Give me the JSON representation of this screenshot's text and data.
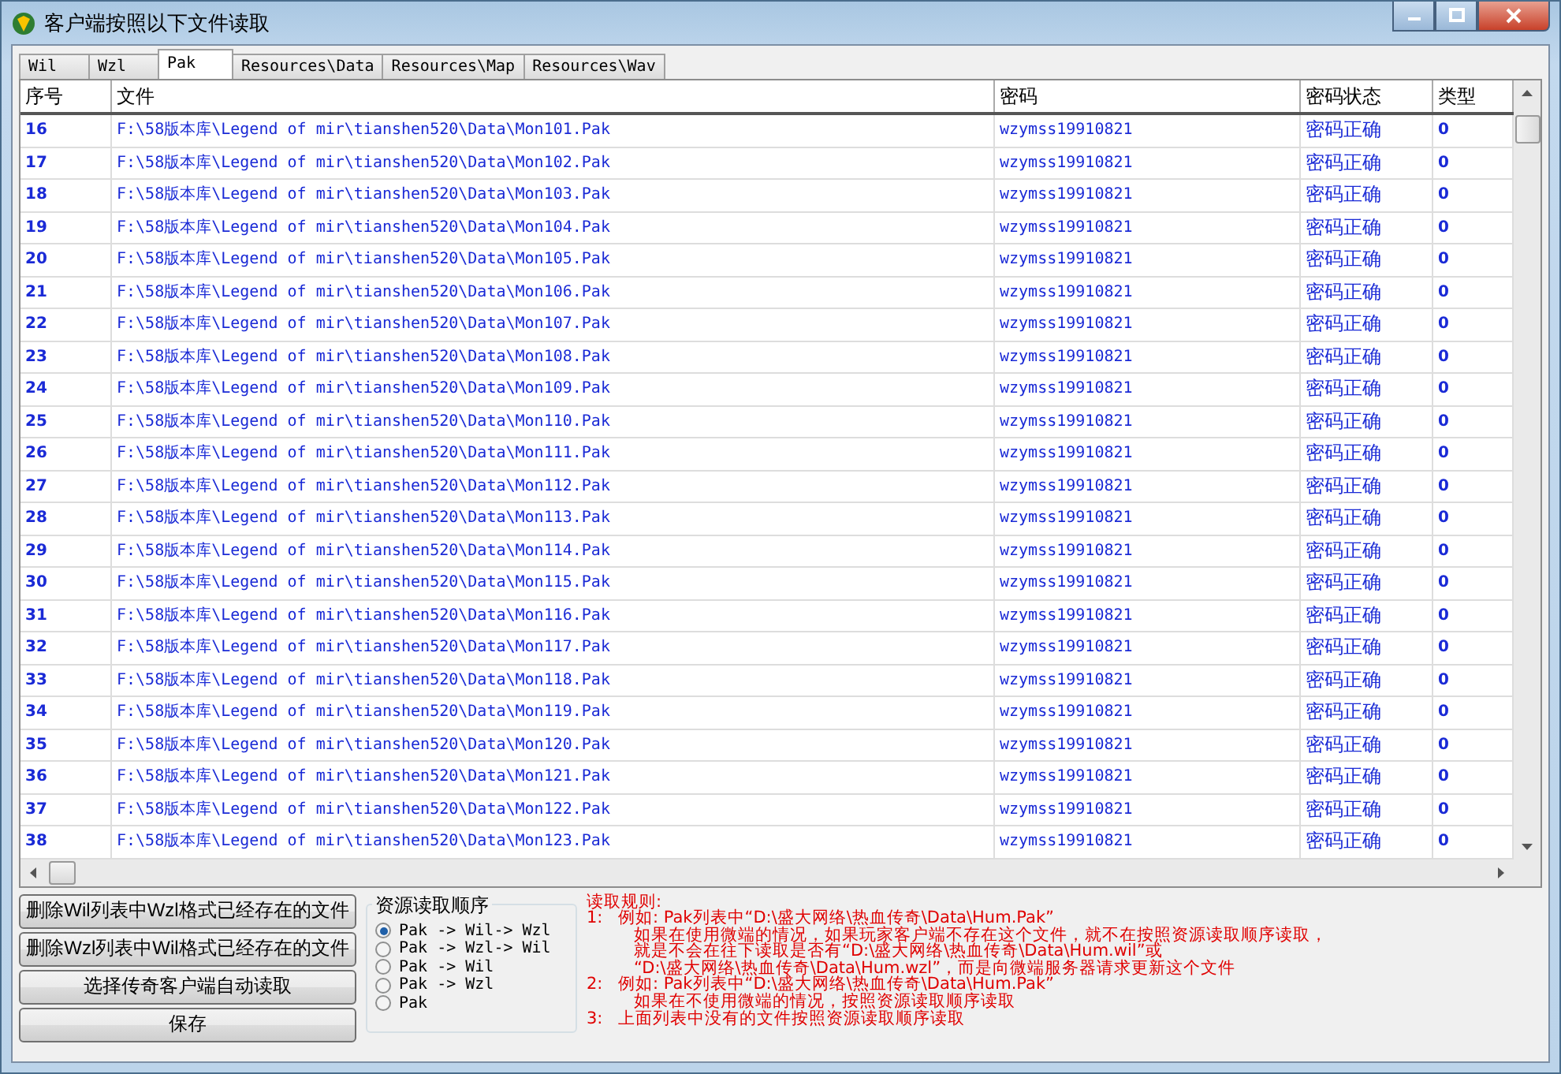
{
  "window": {
    "title": "客户端按照以下文件读取"
  },
  "tabs": [
    {
      "label": "Wil",
      "selected": false
    },
    {
      "label": "Wzl",
      "selected": false
    },
    {
      "label": "Pak",
      "selected": true
    },
    {
      "label": "Resources\\Data",
      "selected": false
    },
    {
      "label": "Resources\\Map",
      "selected": false
    },
    {
      "label": "Resources\\Wav",
      "selected": false
    }
  ],
  "table": {
    "columns": [
      "序号",
      "文件",
      "密码",
      "密码状态",
      "类型"
    ],
    "rows": [
      [
        "16",
        "F:\\58版本库\\Legend of mir\\tianshen520\\Data\\Mon101.Pak",
        "wzymss19910821",
        "密码正确",
        "0"
      ],
      [
        "17",
        "F:\\58版本库\\Legend of mir\\tianshen520\\Data\\Mon102.Pak",
        "wzymss19910821",
        "密码正确",
        "0"
      ],
      [
        "18",
        "F:\\58版本库\\Legend of mir\\tianshen520\\Data\\Mon103.Pak",
        "wzymss19910821",
        "密码正确",
        "0"
      ],
      [
        "19",
        "F:\\58版本库\\Legend of mir\\tianshen520\\Data\\Mon104.Pak",
        "wzymss19910821",
        "密码正确",
        "0"
      ],
      [
        "20",
        "F:\\58版本库\\Legend of mir\\tianshen520\\Data\\Mon105.Pak",
        "wzymss19910821",
        "密码正确",
        "0"
      ],
      [
        "21",
        "F:\\58版本库\\Legend of mir\\tianshen520\\Data\\Mon106.Pak",
        "wzymss19910821",
        "密码正确",
        "0"
      ],
      [
        "22",
        "F:\\58版本库\\Legend of mir\\tianshen520\\Data\\Mon107.Pak",
        "wzymss19910821",
        "密码正确",
        "0"
      ],
      [
        "23",
        "F:\\58版本库\\Legend of mir\\tianshen520\\Data\\Mon108.Pak",
        "wzymss19910821",
        "密码正确",
        "0"
      ],
      [
        "24",
        "F:\\58版本库\\Legend of mir\\tianshen520\\Data\\Mon109.Pak",
        "wzymss19910821",
        "密码正确",
        "0"
      ],
      [
        "25",
        "F:\\58版本库\\Legend of mir\\tianshen520\\Data\\Mon110.Pak",
        "wzymss19910821",
        "密码正确",
        "0"
      ],
      [
        "26",
        "F:\\58版本库\\Legend of mir\\tianshen520\\Data\\Mon111.Pak",
        "wzymss19910821",
        "密码正确",
        "0"
      ],
      [
        "27",
        "F:\\58版本库\\Legend of mir\\tianshen520\\Data\\Mon112.Pak",
        "wzymss19910821",
        "密码正确",
        "0"
      ],
      [
        "28",
        "F:\\58版本库\\Legend of mir\\tianshen520\\Data\\Mon113.Pak",
        "wzymss19910821",
        "密码正确",
        "0"
      ],
      [
        "29",
        "F:\\58版本库\\Legend of mir\\tianshen520\\Data\\Mon114.Pak",
        "wzymss19910821",
        "密码正确",
        "0"
      ],
      [
        "30",
        "F:\\58版本库\\Legend of mir\\tianshen520\\Data\\Mon115.Pak",
        "wzymss19910821",
        "密码正确",
        "0"
      ],
      [
        "31",
        "F:\\58版本库\\Legend of mir\\tianshen520\\Data\\Mon116.Pak",
        "wzymss19910821",
        "密码正确",
        "0"
      ],
      [
        "32",
        "F:\\58版本库\\Legend of mir\\tianshen520\\Data\\Mon117.Pak",
        "wzymss19910821",
        "密码正确",
        "0"
      ],
      [
        "33",
        "F:\\58版本库\\Legend of mir\\tianshen520\\Data\\Mon118.Pak",
        "wzymss19910821",
        "密码正确",
        "0"
      ],
      [
        "34",
        "F:\\58版本库\\Legend of mir\\tianshen520\\Data\\Mon119.Pak",
        "wzymss19910821",
        "密码正确",
        "0"
      ],
      [
        "35",
        "F:\\58版本库\\Legend of mir\\tianshen520\\Data\\Mon120.Pak",
        "wzymss19910821",
        "密码正确",
        "0"
      ],
      [
        "36",
        "F:\\58版本库\\Legend of mir\\tianshen520\\Data\\Mon121.Pak",
        "wzymss19910821",
        "密码正确",
        "0"
      ],
      [
        "37",
        "F:\\58版本库\\Legend of mir\\tianshen520\\Data\\Mon122.Pak",
        "wzymss19910821",
        "密码正确",
        "0"
      ],
      [
        "38",
        "F:\\58版本库\\Legend of mir\\tianshen520\\Data\\Mon123.Pak",
        "wzymss19910821",
        "密码正确",
        "0"
      ]
    ]
  },
  "buttons": [
    "删除Wil列表中Wzl格式已经存在的文件",
    "删除Wzl列表中Wil格式已经存在的文件",
    "选择传奇客户端自动读取",
    "保存"
  ],
  "read_order": {
    "title": "资源读取顺序",
    "options": [
      {
        "label": "Pak -> Wil-> Wzl",
        "selected": true
      },
      {
        "label": "Pak -> Wzl-> Wil",
        "selected": false
      },
      {
        "label": "Pak -> Wil",
        "selected": false
      },
      {
        "label": "Pak -> Wzl",
        "selected": false
      },
      {
        "label": "Pak",
        "selected": false
      }
    ]
  },
  "rules": {
    "title": "读取规则:",
    "items": [
      {
        "marker": "1:",
        "lines": [
          "例如: Pak列表中“D:\\盛大网络\\热血传奇\\Data\\Hum.Pak”",
          "如果在使用微端的情况，如果玩家客户端不存在这个文件，就不在按照资源读取顺序读取，",
          "就是不会在往下读取是否有“D:\\盛大网络\\热血传奇\\Data\\Hum.wil”或",
          "“D:\\盛大网络\\热血传奇\\Data\\Hum.wzl”，而是向微端服务器请求更新这个文件"
        ]
      },
      {
        "marker": "2:",
        "lines": [
          "例如: Pak列表中“D:\\盛大网络\\热血传奇\\Data\\Hum.Pak”",
          "如果在不使用微端的情况，按照资源读取顺序读取"
        ]
      },
      {
        "marker": "3:",
        "lines": [
          "上面列表中没有的文件按照资源读取顺序读取"
        ]
      }
    ]
  }
}
